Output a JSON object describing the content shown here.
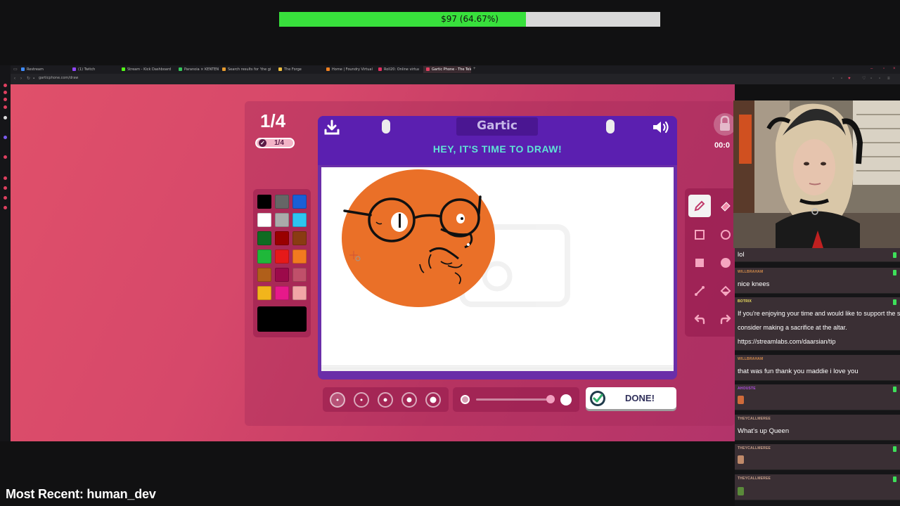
{
  "stream_overlay": {
    "goal_text": "$97 (64.67%)",
    "goal_fraction": 0.6467,
    "goal_fill_color": "#38e03c",
    "most_recent": "Most Recent: human_dev"
  },
  "browser": {
    "tabs": [
      {
        "label": "Restream",
        "fav": "#3f8cff"
      },
      {
        "label": "(1) Twitch",
        "fav": "#9146ff"
      },
      {
        "label": "Stream - Kick Dashboard",
        "fav": "#53fc18"
      },
      {
        "label": "Paranoia × KENTEN",
        "fav": "#36c75b"
      },
      {
        "label": "Search results for 'the gi",
        "fav": "#e69b2f"
      },
      {
        "label": "The Forge",
        "fav": "#f0c040"
      },
      {
        "label": "Home | Foundry Virtual T",
        "fav": "#f08020"
      },
      {
        "label": "Roll20: Online virtual ta",
        "fav": "#e03060"
      },
      {
        "label": "Gartic Phone - The Teleg",
        "fav": "#e04060"
      }
    ],
    "url": "garticphone.com/draw"
  },
  "game": {
    "round_big": "1/4",
    "round_pill": "1/4",
    "logo": "Gartic",
    "title": "HEY, IT'S TIME TO DRAW!",
    "done_label": "DONE!",
    "timer": "00:0",
    "palette": [
      "#000000",
      "#666666",
      "#1a5fd6",
      "#ffffff",
      "#aaaaaa",
      "#2ec4f0",
      "#106b22",
      "#990000",
      "#8a3b12",
      "#1fb83a",
      "#e61919",
      "#f27a1f",
      "#b05f1a",
      "#9c0a4a",
      "#c0506a",
      "#f2b51b",
      "#e6198a",
      "#f2a6a6"
    ],
    "current_color": "#000000",
    "accent_purple": "#5b1fb0",
    "teal_title": "#5fe3d6"
  },
  "chat": {
    "messages": [
      {
        "user": "",
        "text": "lol",
        "user_color": "#8a8a8a"
      },
      {
        "user": "WILLBRAHAM",
        "text": "nice knees",
        "user_color": "#d08a4a"
      },
      {
        "user": "BOTRIX",
        "text": "If you're enjoying your time and would like to support the stream,",
        "text2": "consider making a sacrifice at the altar.",
        "text3": "https://streamlabs.com/daarsian/tip",
        "user_color": "#f0e060"
      },
      {
        "user": "WILLBRAHAM",
        "text": "that was fun thank you maddie i love you",
        "user_color": "#d08a4a"
      },
      {
        "user": "AHOUSTE",
        "text": "",
        "user_color": "#b050e0"
      },
      {
        "user": "THEYCALLMEREE",
        "text": "What's up Queen",
        "user_color": "#c8a08a"
      },
      {
        "user": "THEYCALLMEREE",
        "text": "",
        "user_color": "#c8a08a"
      },
      {
        "user": "THEYCALLMEREE",
        "text": "",
        "user_color": "#c8a08a"
      }
    ]
  }
}
